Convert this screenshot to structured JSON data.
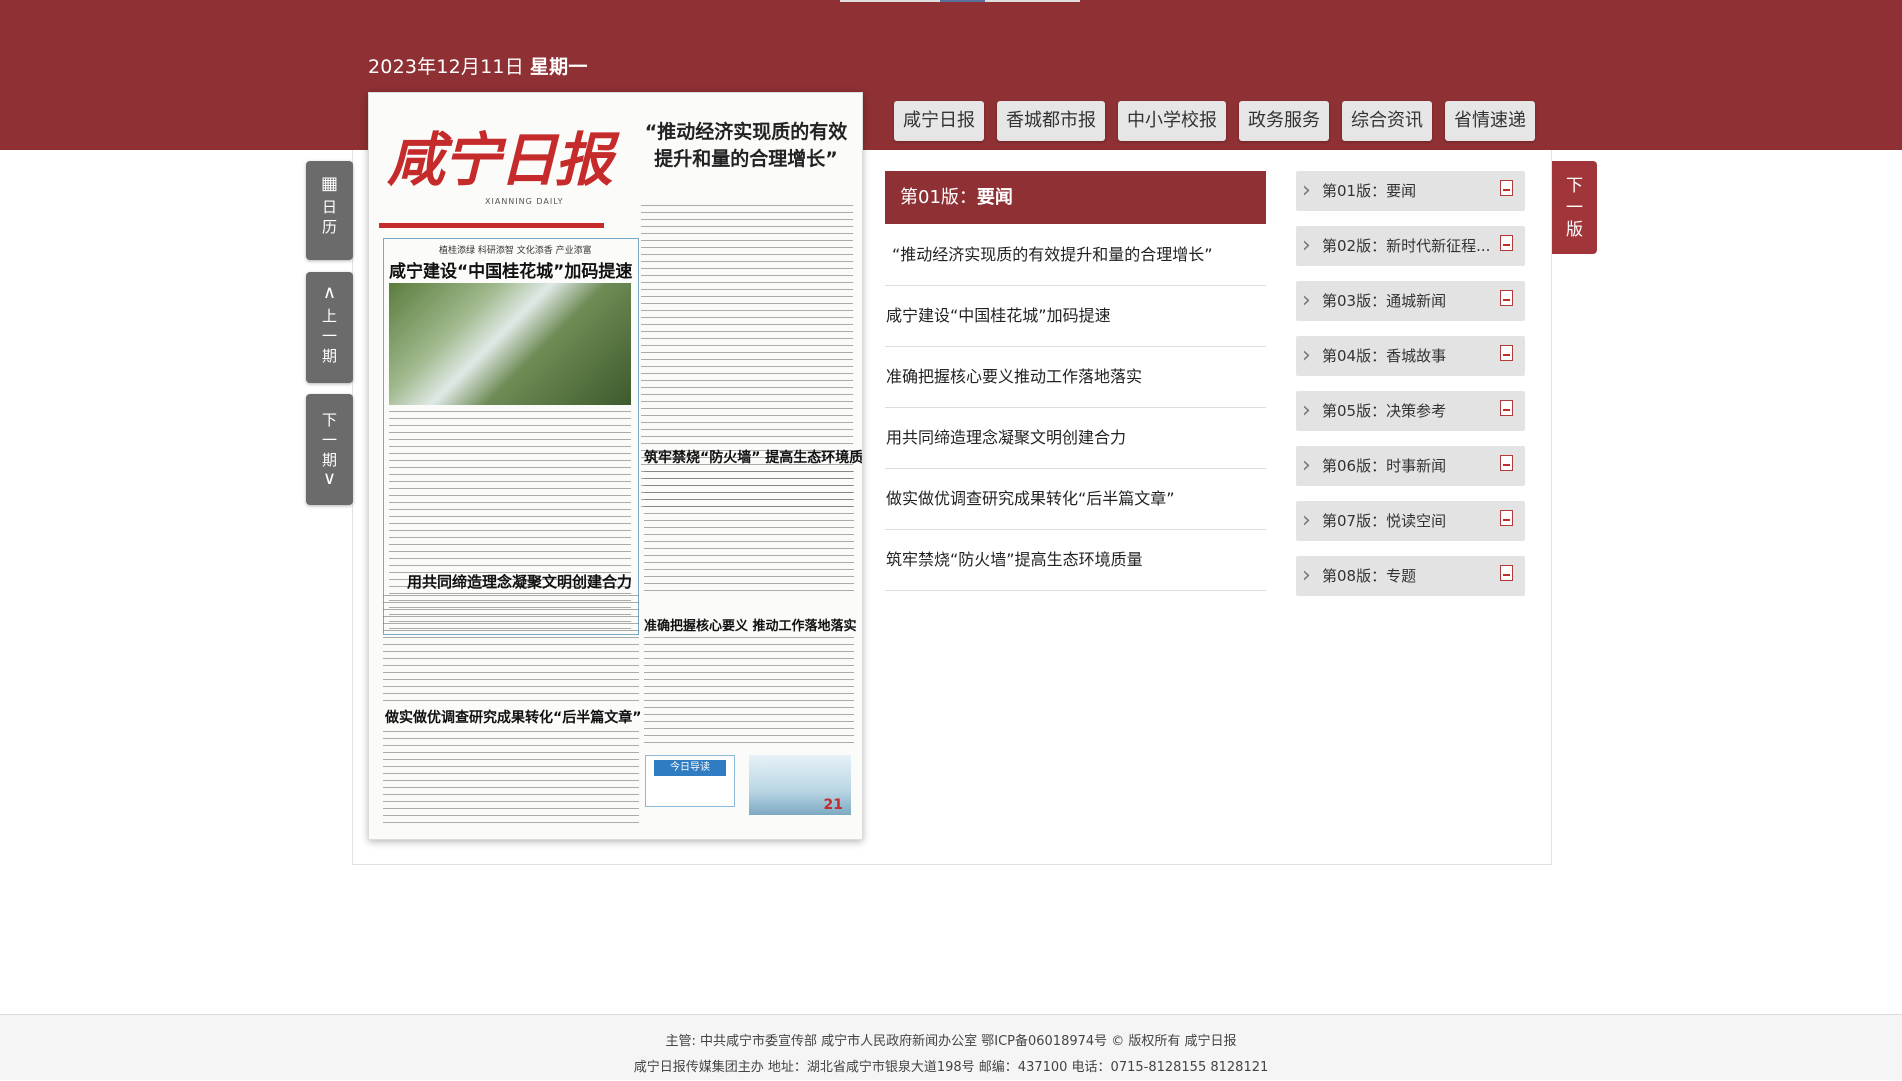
{
  "header": {
    "date": "2023年12月11日",
    "weekday": "星期一",
    "nav": [
      "咸宁日报",
      "香城都市报",
      "中小学校报",
      "政务服务",
      "综合资讯",
      "省情速递"
    ]
  },
  "side_controls": {
    "calendar_label_1": "日",
    "calendar_label_2": "历",
    "prev_label_1": "上",
    "prev_label_2": "一",
    "prev_label_3": "期",
    "next_label_1": "下",
    "next_label_2": "一",
    "next_label_3": "期"
  },
  "next_page_tab": {
    "line1": "下",
    "line2": "一",
    "line3": "版"
  },
  "paper": {
    "masthead": "咸宁日报",
    "masthead_sub": "XIANNING DAILY",
    "headline": "“推动经济实现质的有效提升和量的合理增长”",
    "box_kicker": "植桂添绿   科研添智   文化添香   产业添富",
    "box_title": "咸宁建设“中国桂花城”加码提速",
    "sub1": "筑牢禁烧“防火墙”   提高生态环境质量",
    "sub2": "用共同缔造理念凝聚文明创建合力",
    "sub3": "准确把握核心要义   推动工作落地落实",
    "sub4": "做实做优调查研究成果转化“后半篇文章”",
    "guide_label": "今日导读",
    "ad_number": "21"
  },
  "edition": {
    "number_label": "第01版：",
    "name": "要闻"
  },
  "articles": [
    "“推动经济实现质的有效提升和量的合理增长”",
    "咸宁建设“中国桂花城”加码提速",
    "准确把握核心要义推动工作落地落实",
    "用共同缔造理念凝聚文明创建合力",
    "做实做优调查研究成果转化“后半篇文章”",
    "筑牢禁烧“防火墙”提高生态环境质量"
  ],
  "pages": [
    "第01版：要闻",
    "第02版：新时代新征程...",
    "第03版：通城新闻",
    "第04版：香城故事",
    "第05版：决策参考",
    "第06版：时事新闻",
    "第07版：悦读空间",
    "第08版：专题"
  ],
  "footer": {
    "line1": "主管: 中共咸宁市委宣传部    咸宁市人民政府新闻办公室    鄂ICP备06018974号    © 版权所有    咸宁日报",
    "line2": "咸宁日报传媒集团主办 地址：湖北省咸宁市银泉大道198号    邮编：437100    电话：0715-8128155 8128121"
  },
  "colors": {
    "brand_red": "#8e3034",
    "tab_gray": "#e6e6e6",
    "side_button_gray": "#6b6b6b"
  }
}
